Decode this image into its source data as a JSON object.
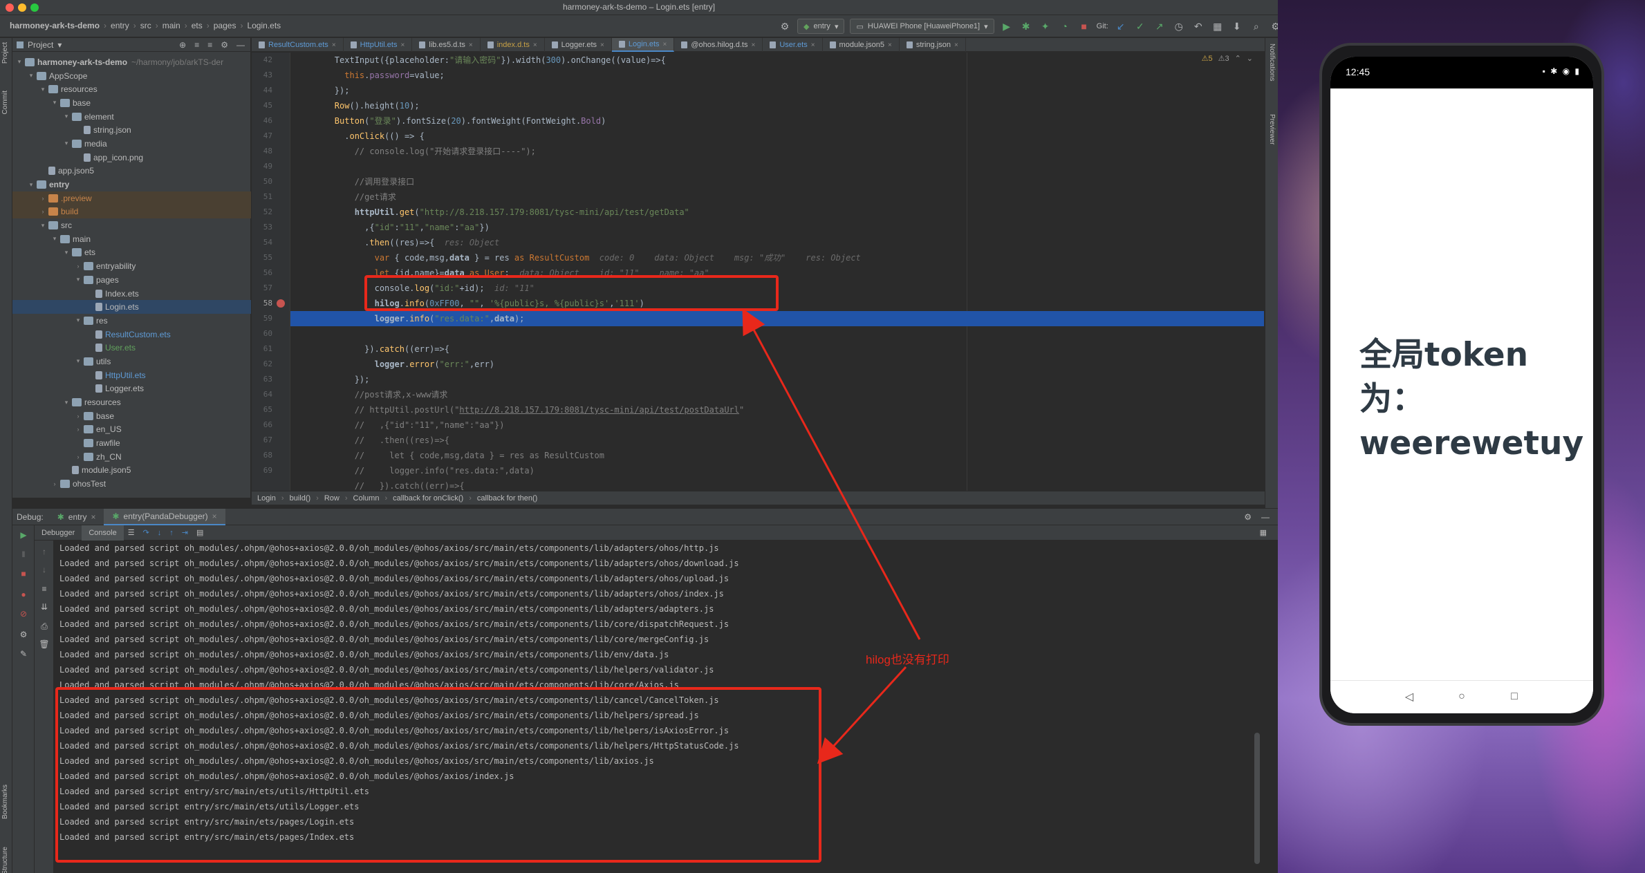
{
  "window": {
    "title": "harmoney-ark-ts-demo – Login.ets [entry]",
    "traffic_lights": [
      "#ff5f57",
      "#febc2e",
      "#28c840"
    ]
  },
  "breadcrumb": [
    "harmoney-ark-ts-demo",
    "entry",
    "src",
    "main",
    "ets",
    "pages",
    "Login.ets"
  ],
  "toolbar": {
    "module_combo": "entry",
    "device_combo": "HUAWEI Phone [HuaweiPhone1]",
    "git_label": "Git:"
  },
  "left_strip": {
    "project_label": "Project",
    "commit_label": "Commit",
    "bookmarks_label": "Bookmarks",
    "structure_label": "Structure"
  },
  "project_panel": {
    "header": "Project",
    "tree": [
      {
        "label": "harmoney-ark-ts-demo",
        "suffix": "~/harmony/job/arkTS-der",
        "depth": 0,
        "open": true,
        "kind": "folder",
        "bold": true
      },
      {
        "label": "AppScope",
        "depth": 1,
        "open": true,
        "kind": "folder"
      },
      {
        "label": "resources",
        "depth": 2,
        "open": true,
        "kind": "folder"
      },
      {
        "label": "base",
        "depth": 3,
        "open": true,
        "kind": "folder"
      },
      {
        "label": "element",
        "depth": 4,
        "open": true,
        "kind": "folder"
      },
      {
        "label": "string.json",
        "depth": 5,
        "kind": "file"
      },
      {
        "label": "media",
        "depth": 4,
        "open": true,
        "kind": "folder"
      },
      {
        "label": "app_icon.png",
        "depth": 5,
        "kind": "file"
      },
      {
        "label": "app.json5",
        "depth": 2,
        "kind": "file"
      },
      {
        "label": "entry",
        "depth": 1,
        "open": true,
        "kind": "folder",
        "bold": true
      },
      {
        "label": ".preview",
        "depth": 2,
        "open": false,
        "kind": "folder-o",
        "style": "orange",
        "row": "dim"
      },
      {
        "label": "build",
        "depth": 2,
        "open": false,
        "kind": "folder-o",
        "style": "orange",
        "row": "dim"
      },
      {
        "label": "src",
        "depth": 2,
        "open": true,
        "kind": "folder"
      },
      {
        "label": "main",
        "depth": 3,
        "open": true,
        "kind": "folder"
      },
      {
        "label": "ets",
        "depth": 4,
        "open": true,
        "kind": "folder"
      },
      {
        "label": "entryability",
        "depth": 5,
        "open": false,
        "kind": "folder"
      },
      {
        "label": "pages",
        "depth": 5,
        "open": true,
        "kind": "folder"
      },
      {
        "label": "Index.ets",
        "depth": 6,
        "kind": "file"
      },
      {
        "label": "Login.ets",
        "depth": 6,
        "kind": "file",
        "row": "sel"
      },
      {
        "label": "res",
        "depth": 5,
        "open": true,
        "kind": "folder"
      },
      {
        "label": "ResultCustom.ets",
        "depth": 6,
        "kind": "file",
        "style": "blue"
      },
      {
        "label": "User.ets",
        "depth": 6,
        "kind": "file",
        "style": "green"
      },
      {
        "label": "utils",
        "depth": 5,
        "open": true,
        "kind": "folder"
      },
      {
        "label": "HttpUtil.ets",
        "depth": 6,
        "kind": "file",
        "style": "blue"
      },
      {
        "label": "Logger.ets",
        "depth": 6,
        "kind": "file"
      },
      {
        "label": "resources",
        "depth": 4,
        "open": true,
        "kind": "folder"
      },
      {
        "label": "base",
        "depth": 5,
        "open": false,
        "kind": "folder"
      },
      {
        "label": "en_US",
        "depth": 5,
        "open": false,
        "kind": "folder"
      },
      {
        "label": "rawfile",
        "depth": 5,
        "kind": "folder"
      },
      {
        "label": "zh_CN",
        "depth": 5,
        "open": false,
        "kind": "folder"
      },
      {
        "label": "module.json5",
        "depth": 4,
        "kind": "file"
      },
      {
        "label": "ohosTest",
        "depth": 3,
        "open": false,
        "kind": "folder"
      }
    ]
  },
  "tabs": [
    {
      "label": "ResultCustom.ets",
      "style": "blue"
    },
    {
      "label": "HttpUtil.ets",
      "style": "blue"
    },
    {
      "label": "lib.es5.d.ts"
    },
    {
      "label": "index.d.ts",
      "style": "yellow"
    },
    {
      "label": "Logger.ets"
    },
    {
      "label": "Login.ets",
      "active": true,
      "style": "blue"
    },
    {
      "label": "@ohos.hilog.d.ts"
    },
    {
      "label": "User.ets",
      "style": "blue"
    },
    {
      "label": "module.json5"
    },
    {
      "label": "string.json"
    }
  ],
  "editor": {
    "inspections": {
      "warnings": "5",
      "weak_warnings": "3"
    },
    "line_numbers": [
      "42",
      "43",
      "44",
      "45",
      "46",
      "47",
      "48",
      "49",
      "50",
      "51",
      "52",
      "53",
      "54",
      "55",
      "56",
      "57",
      "58",
      "59",
      "60",
      "61",
      "62",
      "63",
      "64",
      "65",
      "66",
      "67",
      "68",
      "69"
    ],
    "breakpoint_line": "58",
    "highlight_line": "58"
  },
  "editor_crumbs": [
    "Login",
    "build()",
    "Row",
    "Column",
    "callback for onClick()",
    "callback for then()"
  ],
  "debug": {
    "label": "Debug:",
    "tabs": [
      "entry",
      "entry(PandaDebugger)"
    ],
    "subtabs": [
      "Debugger",
      "Console"
    ],
    "console_lines": [
      "Loaded and parsed script oh_modules/.ohpm/@ohos+axios@2.0.0/oh_modules/@ohos/axios/src/main/ets/components/lib/adapters/ohos/http.js",
      "Loaded and parsed script oh_modules/.ohpm/@ohos+axios@2.0.0/oh_modules/@ohos/axios/src/main/ets/components/lib/adapters/ohos/download.js",
      "Loaded and parsed script oh_modules/.ohpm/@ohos+axios@2.0.0/oh_modules/@ohos/axios/src/main/ets/components/lib/adapters/ohos/upload.js",
      "Loaded and parsed script oh_modules/.ohpm/@ohos+axios@2.0.0/oh_modules/@ohos/axios/src/main/ets/components/lib/adapters/ohos/index.js",
      "Loaded and parsed script oh_modules/.ohpm/@ohos+axios@2.0.0/oh_modules/@ohos/axios/src/main/ets/components/lib/adapters/adapters.js",
      "Loaded and parsed script oh_modules/.ohpm/@ohos+axios@2.0.0/oh_modules/@ohos/axios/src/main/ets/components/lib/core/dispatchRequest.js",
      "Loaded and parsed script oh_modules/.ohpm/@ohos+axios@2.0.0/oh_modules/@ohos/axios/src/main/ets/components/lib/core/mergeConfig.js",
      "Loaded and parsed script oh_modules/.ohpm/@ohos+axios@2.0.0/oh_modules/@ohos/axios/src/main/ets/components/lib/env/data.js",
      "Loaded and parsed script oh_modules/.ohpm/@ohos+axios@2.0.0/oh_modules/@ohos/axios/src/main/ets/components/lib/helpers/validator.js",
      "Loaded and parsed script oh_modules/.ohpm/@ohos+axios@2.0.0/oh_modules/@ohos/axios/src/main/ets/components/lib/core/Axios.js",
      "Loaded and parsed script oh_modules/.ohpm/@ohos+axios@2.0.0/oh_modules/@ohos/axios/src/main/ets/components/lib/cancel/CancelToken.js",
      "Loaded and parsed script oh_modules/.ohpm/@ohos+axios@2.0.0/oh_modules/@ohos/axios/src/main/ets/components/lib/helpers/spread.js",
      "Loaded and parsed script oh_modules/.ohpm/@ohos+axios@2.0.0/oh_modules/@ohos/axios/src/main/ets/components/lib/helpers/isAxiosError.js",
      "Loaded and parsed script oh_modules/.ohpm/@ohos+axios@2.0.0/oh_modules/@ohos/axios/src/main/ets/components/lib/helpers/HttpStatusCode.js",
      "Loaded and parsed script oh_modules/.ohpm/@ohos+axios@2.0.0/oh_modules/@ohos/axios/src/main/ets/components/lib/axios.js",
      "Loaded and parsed script oh_modules/.ohpm/@ohos+axios@2.0.0/oh_modules/@ohos/axios/index.js",
      "Loaded and parsed script entry/src/main/ets/utils/HttpUtil.ets",
      "Loaded and parsed script entry/src/main/ets/utils/Logger.ets",
      "Loaded and parsed script entry/src/main/ets/pages/Login.ets",
      "Loaded and parsed script entry/src/main/ets/pages/Index.ets"
    ]
  },
  "annotation": {
    "text": "hilog也没有打印",
    "color": "#e8281b"
  },
  "right_strip": {
    "notifications_label": "Notifications",
    "previewer_label": "Previewer"
  },
  "phone": {
    "time": "12:45",
    "status_icons": "▪ ✱ ◉ ▮",
    "content_text": "全局token为：weerewetuy",
    "nav": [
      "◁",
      "○",
      "□"
    ]
  }
}
